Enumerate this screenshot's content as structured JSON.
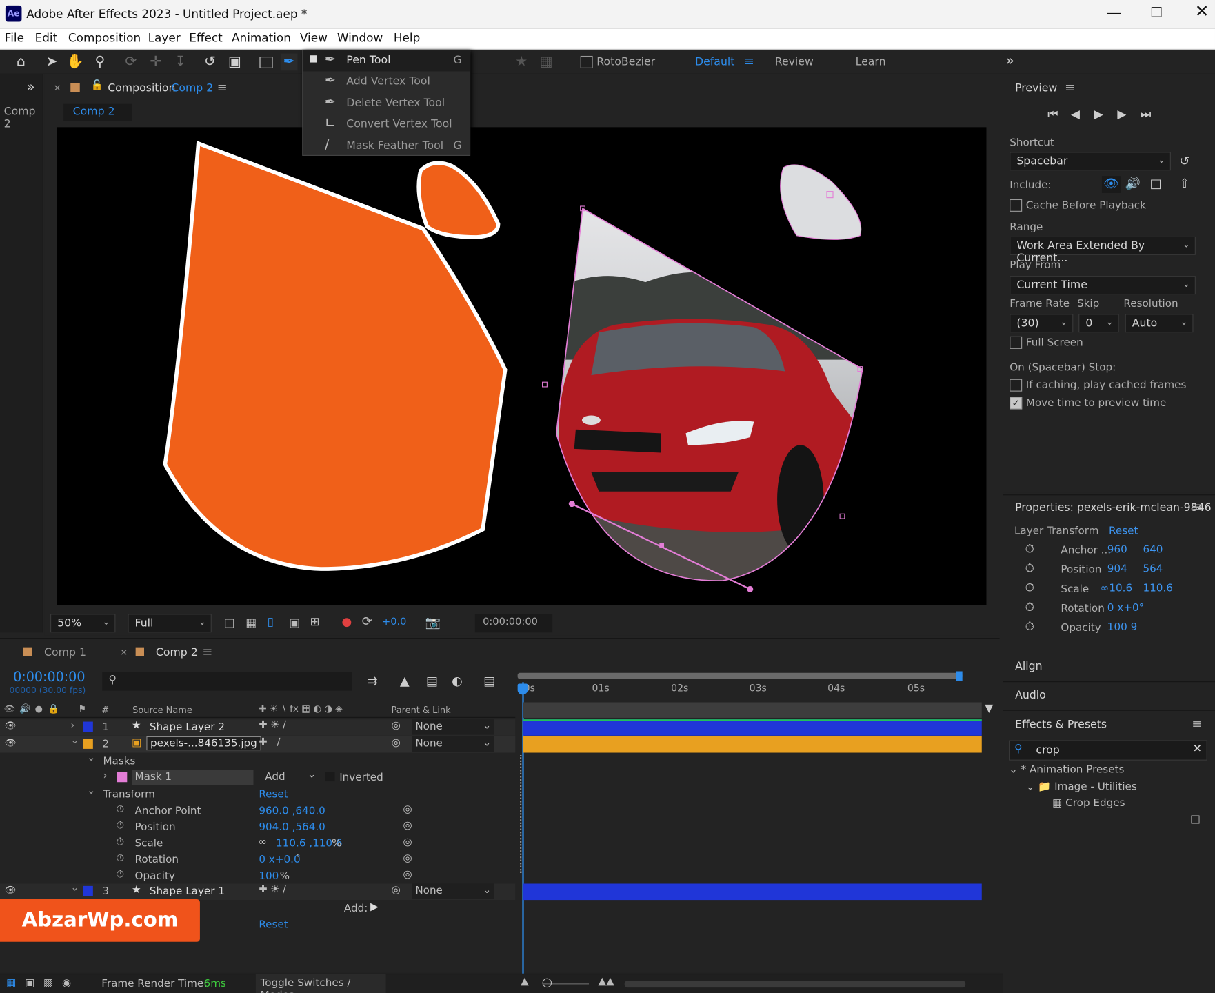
{
  "window": {
    "app_icon": "Ae",
    "title": "Adobe After Effects 2023 - Untitled Project.aep *"
  },
  "menu": [
    "File",
    "Edit",
    "Composition",
    "Layer",
    "Effect",
    "Animation",
    "View",
    "Window",
    "Help"
  ],
  "toolbar": {
    "rotobezier_label": "RotoBezier",
    "workspaces": [
      "Default",
      "Review",
      "Learn"
    ]
  },
  "tool_flyout": [
    {
      "label": "Pen Tool",
      "shortcut": "G"
    },
    {
      "label": "Add Vertex Tool",
      "shortcut": ""
    },
    {
      "label": "Delete Vertex Tool",
      "shortcut": ""
    },
    {
      "label": "Convert Vertex Tool",
      "shortcut": ""
    },
    {
      "label": "Mask Feather Tool",
      "shortcut": "G"
    }
  ],
  "left_tab": "Comp 2",
  "composition_panel": {
    "prefix": "Composition",
    "name": "Comp 2",
    "subtab": "Comp 2"
  },
  "viewer_bar": {
    "zoom": "50%",
    "resolution": "Full",
    "exposure": "+0.0",
    "timecode": "0:00:00:00"
  },
  "preview": {
    "title": "Preview",
    "shortcut_label": "Shortcut",
    "shortcut_value": "Spacebar",
    "include_label": "Include:",
    "cache_label": "Cache Before Playback",
    "range_label": "Range",
    "range_value": "Work Area Extended By Current...",
    "play_from_label": "Play From",
    "play_from_value": "Current Time",
    "frame_rate_label": "Frame Rate",
    "skip_label": "Skip",
    "resolution_label": "Resolution",
    "frame_rate_value": "(30)",
    "skip_value": "0",
    "resolution_value": "Auto",
    "full_screen_label": "Full Screen",
    "stop_label": "On (Spacebar) Stop:",
    "if_caching_label": "If caching, play cached frames",
    "move_time_label": "Move time to preview time"
  },
  "properties": {
    "title": "Properties: pexels-erik-mclean-9846",
    "section": "Layer Transform",
    "reset": "Reset",
    "rows": [
      {
        "label": "Anchor ...",
        "v1": "960",
        "v2": "640"
      },
      {
        "label": "Position",
        "v1": "904",
        "v2": "564"
      },
      {
        "label": "Scale",
        "v1": "∞10.6",
        "v2": "110.6"
      },
      {
        "label": "Rotation",
        "v1": "0 x+0°",
        "v2": ""
      },
      {
        "label": "Opacity",
        "v1": "100 9",
        "v2": ""
      }
    ]
  },
  "side_panels": [
    "Align",
    "Audio"
  ],
  "effects": {
    "title": "Effects & Presets",
    "search": "crop",
    "tree": [
      {
        "label": "* Animation Presets"
      },
      {
        "label": "Image - Utilities"
      },
      {
        "label": "Crop Edges"
      }
    ]
  },
  "timeline": {
    "tabs": [
      "Comp 1",
      "Comp 2"
    ],
    "timecode": "0:00:00:00",
    "fps": "00000 (30.00 fps)",
    "ruler": [
      "0s",
      "01s",
      "02s",
      "03s",
      "04s",
      "05s"
    ],
    "col_source": "Source Name",
    "col_parent": "Parent & Link",
    "col_num": "#",
    "layers": [
      {
        "num": "1",
        "name": "Shape Layer 2",
        "parent": "None",
        "color": "#2036d8"
      },
      {
        "num": "2",
        "name": "pexels-...846135.jpg",
        "parent": "None",
        "color": "#e8a020"
      },
      {
        "num": "3",
        "name": "Shape Layer 1",
        "parent": "None",
        "color": "#2036d8"
      }
    ],
    "masks_label": "Masks",
    "mask_name": "Mask 1",
    "mask_mode": "Add",
    "inverted_label": "Inverted",
    "transform_label": "Transform",
    "reset": "Reset",
    "transform": [
      {
        "label": "Anchor Point",
        "value": "960.0 ,640.0"
      },
      {
        "label": "Position",
        "value": "904.0 ,564.0"
      },
      {
        "label": "Scale",
        "value": "110.6 ,110.6",
        "unit": "%"
      },
      {
        "label": "Rotation",
        "value": "0 x+0.0",
        "unit": "°"
      },
      {
        "label": "Opacity",
        "value": "100",
        "unit": "%"
      }
    ],
    "add_label": "Add:"
  },
  "status": {
    "render_label": "Frame Render Time:",
    "render_value": "6ms",
    "toggle": "Toggle Switches / Modes"
  },
  "watermark": "AbzarWp.com"
}
